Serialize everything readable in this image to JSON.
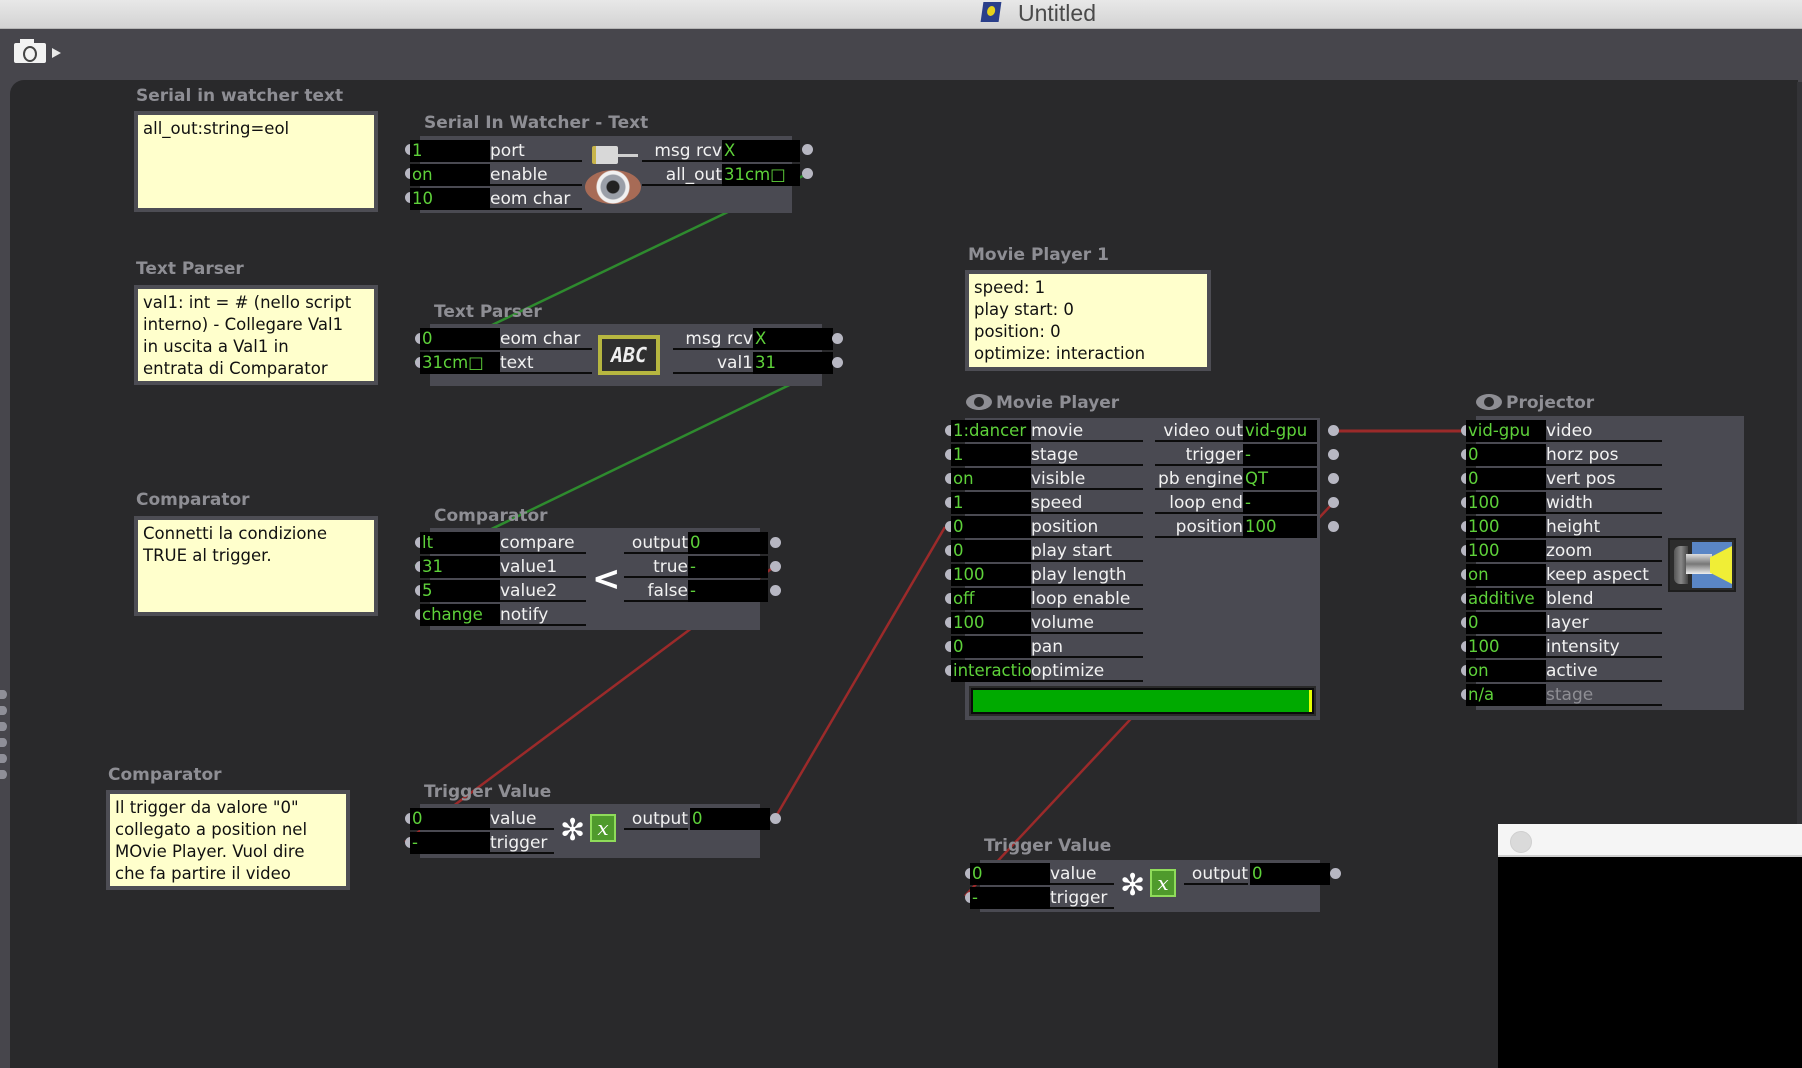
{
  "window": {
    "title": "Untitled",
    "app_icon": "isadora-document-icon"
  },
  "toolbar": {
    "snapshot_icon": "camera-icon",
    "menu_arrow_icon": "play-arrow-icon"
  },
  "comments": [
    {
      "title": "Serial in watcher text",
      "text": "all_out:string=eol"
    },
    {
      "title": "Text Parser",
      "text": "val1: int = # (nello script\ninterno) - Collegare Val1\nin uscita a Val1 in\nentrata di Comparator"
    },
    {
      "title": "Comparator",
      "text": "Connetti la condizione\nTRUE al trigger."
    },
    {
      "title": "Comparator",
      "text": "Il trigger da valore \"0\"\ncollegato a position nel\nMOvie Player. Vuol dire\nche fa partire il video"
    },
    {
      "title": "Movie Player 1",
      "text": "speed: 1\nplay start: 0\nposition: 0\noptimize: interaction"
    }
  ],
  "actors": {
    "serial_in": {
      "title": "Serial In Watcher - Text",
      "inputs": [
        {
          "value": "1",
          "label": "port"
        },
        {
          "value": "on",
          "label": "enable"
        },
        {
          "value": "10",
          "label": "eom char"
        }
      ],
      "outputs": [
        {
          "label": "msg rcv",
          "value": "X"
        },
        {
          "label": "all_out",
          "value": "31cm□"
        }
      ]
    },
    "text_parser": {
      "title": "Text Parser",
      "icon_text": "ABC",
      "inputs": [
        {
          "value": "0",
          "label": "eom char"
        },
        {
          "value": "31cm□",
          "label": "text"
        }
      ],
      "outputs": [
        {
          "label": "msg rcv",
          "value": "X"
        },
        {
          "label": "val1",
          "value": "31"
        }
      ]
    },
    "comparator": {
      "title": "Comparator",
      "icon_text": "<",
      "inputs": [
        {
          "value": "lt",
          "label": "compare"
        },
        {
          "value": "31",
          "label": "value1"
        },
        {
          "value": "5",
          "label": "value2"
        },
        {
          "value": "change",
          "label": "notify"
        }
      ],
      "outputs": [
        {
          "label": "output",
          "value": "0"
        },
        {
          "label": "true",
          "value": "-"
        },
        {
          "label": "false",
          "value": "-"
        }
      ]
    },
    "trigger1": {
      "title": "Trigger Value",
      "inputs": [
        {
          "value": "0",
          "label": "value"
        },
        {
          "value": "-",
          "label": "trigger"
        }
      ],
      "outputs": [
        {
          "label": "output",
          "value": "0"
        }
      ]
    },
    "movie_player": {
      "title": "Movie Player",
      "inputs": [
        {
          "value": "1:dancer",
          "label": "movie"
        },
        {
          "value": "1",
          "label": "stage"
        },
        {
          "value": "on",
          "label": "visible"
        },
        {
          "value": "1",
          "label": "speed"
        },
        {
          "value": "0",
          "label": "position"
        },
        {
          "value": "0",
          "label": "play start"
        },
        {
          "value": "100",
          "label": "play length"
        },
        {
          "value": "off",
          "label": "loop enable"
        },
        {
          "value": "100",
          "label": "volume"
        },
        {
          "value": "0",
          "label": "pan"
        },
        {
          "value": "interaction",
          "label": "optimize"
        }
      ],
      "outputs": [
        {
          "label": "video out",
          "value": "vid-gpu"
        },
        {
          "label": "trigger",
          "value": "-"
        },
        {
          "label": "pb engine",
          "value": "QT"
        },
        {
          "label": "loop end",
          "value": "-"
        },
        {
          "label": "position",
          "value": "100"
        }
      ],
      "playback_progress_percent": 100
    },
    "projector": {
      "title": "Projector",
      "inputs": [
        {
          "value": "vid-gpu",
          "label": "video"
        },
        {
          "value": "0",
          "label": "horz pos"
        },
        {
          "value": "0",
          "label": "vert pos"
        },
        {
          "value": "100",
          "label": "width"
        },
        {
          "value": "100",
          "label": "height"
        },
        {
          "value": "100",
          "label": "zoom"
        },
        {
          "value": "on",
          "label": "keep aspect"
        },
        {
          "value": "additive",
          "label": "blend"
        },
        {
          "value": "0",
          "label": "layer"
        },
        {
          "value": "100",
          "label": "intensity"
        },
        {
          "value": "on",
          "label": "active"
        },
        {
          "value": "n/a",
          "label": "stage"
        }
      ]
    },
    "trigger2": {
      "title": "Trigger Value",
      "inputs": [
        {
          "value": "0",
          "label": "value"
        },
        {
          "value": "-",
          "label": "trigger"
        }
      ],
      "outputs": [
        {
          "label": "output",
          "value": "0"
        }
      ]
    }
  },
  "connections": [
    {
      "from": "serial_in.all_out",
      "to": "text_parser.text",
      "color": "#2e8b2e"
    },
    {
      "from": "text_parser.val1",
      "to": "comparator.value1",
      "color": "#2e8b2e"
    },
    {
      "from": "comparator.true",
      "to": "trigger1.trigger",
      "color": "#9b2a2a"
    },
    {
      "from": "trigger1.output",
      "to": "movie_player.position",
      "color": "#9b2a2a"
    },
    {
      "from": "movie_player.video_out",
      "to": "projector.video",
      "color": "#9b2a2a"
    },
    {
      "from": "movie_player.loop_end",
      "to": "trigger2.trigger",
      "color": "#9b2a2a"
    }
  ]
}
